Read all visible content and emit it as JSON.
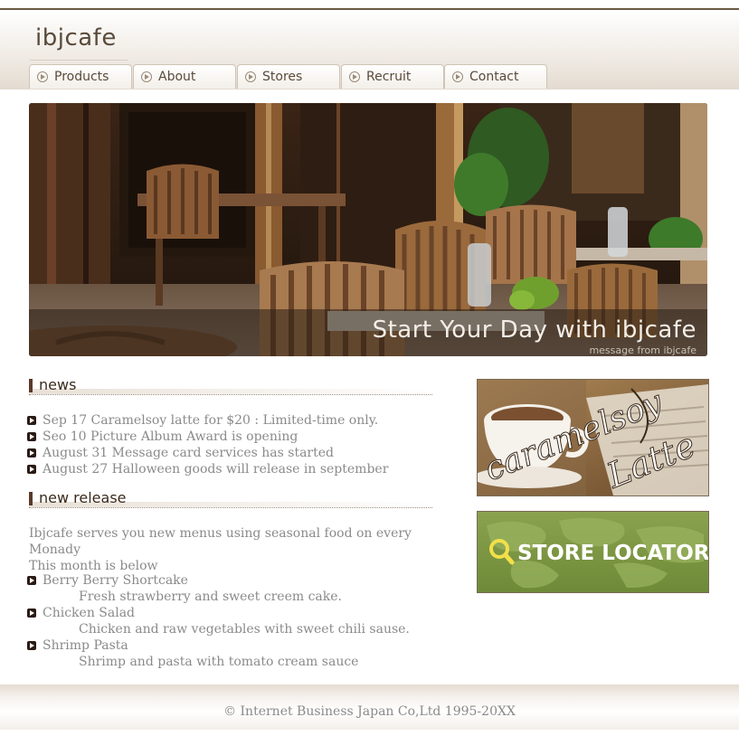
{
  "site": {
    "logo": "ibjcafe"
  },
  "nav": {
    "items": [
      {
        "label": "Products"
      },
      {
        "label": "About"
      },
      {
        "label": "Stores"
      },
      {
        "label": "Recruit"
      },
      {
        "label": "Contact"
      }
    ]
  },
  "hero": {
    "title": "Start Your Day with ibjcafe",
    "subtitle": "message from ibjcafe"
  },
  "news": {
    "heading": "news",
    "items": [
      "Sep 17 Caramelsoy latte for $20 : Limited-time only.",
      "Seo 10 Picture Album Award is opening",
      "August 31 Message card services has started",
      "August 27 Halloween goods will release in september"
    ]
  },
  "new_release": {
    "heading": "new release",
    "intro_line1": "Ibjcafe serves you new menus using seasonal food on every Monady",
    "intro_line2": "This month is below",
    "items": [
      {
        "name": "Berry Berry Shortcake",
        "desc": "Fresh strawberry and sweet creem cake."
      },
      {
        "name": "Chicken Salad",
        "desc": "Chicken and raw vegetables with sweet chili sause."
      },
      {
        "name": "Shrimp Pasta",
        "desc": "Shrimp and pasta with tomato cream sauce"
      }
    ]
  },
  "banners": {
    "latte": {
      "line1": "caramelsoy",
      "line2": "Latte"
    },
    "locator": {
      "label": "STORE LOCATOR"
    }
  },
  "footer": {
    "copyright": "© Internet Business Japan Co,Ltd 1995-20XX"
  }
}
